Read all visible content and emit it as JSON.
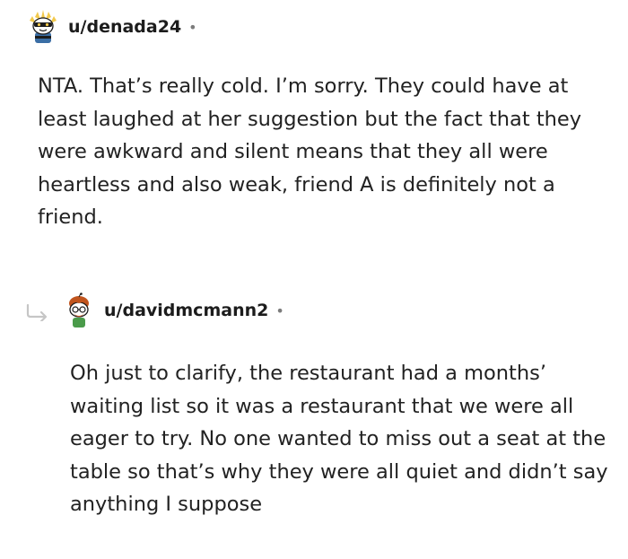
{
  "colors": {
    "text": "#1c1c1c",
    "muted": "#7c7c7c",
    "reply_arrow": "#c6c6c6"
  },
  "comments": [
    {
      "username": "u/denada24",
      "separator": "•",
      "avatar_icon": "bee-snoo-avatar-icon",
      "body": "NTA. That’s really cold. I’m sorry. They could have at least laughed at her suggestion but the fact that they were awkward and silent means that they all were heartless and also weak, friend A is definitely not a friend."
    },
    {
      "username": "u/davidmcmann2",
      "separator": "•",
      "avatar_icon": "red-haired-snoo-avatar-icon",
      "reply_icon": "reply-arrow-icon",
      "body": "Oh just to clarify, the restaurant had a months’ waiting list so it was a restaurant that we were all eager to try. No one wanted to miss out a seat at the table so that’s why they were all quiet and didn’t say anything I suppose"
    }
  ]
}
